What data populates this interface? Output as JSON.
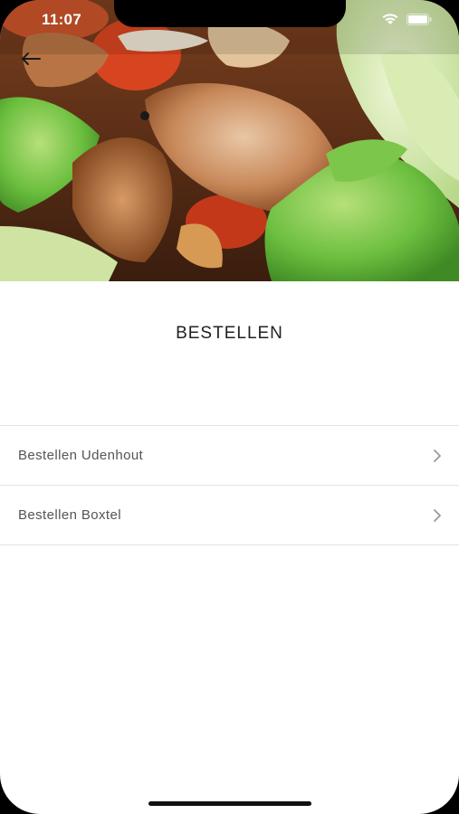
{
  "status_bar": {
    "time": "11:07",
    "icons": [
      "wifi-icon",
      "battery-icon"
    ]
  },
  "header": {
    "back_icon": "arrow-left-icon",
    "image": "food-photo"
  },
  "page": {
    "title": "BESTELLEN"
  },
  "list": {
    "items": [
      {
        "label": "Bestellen Udenhout",
        "icon": "chevron-right-icon"
      },
      {
        "label": "Bestellen Boxtel",
        "icon": "chevron-right-icon"
      }
    ]
  },
  "colors": {
    "background": "#ffffff",
    "title_text": "#222222",
    "item_text": "#555555",
    "divider": "#e2e2e2",
    "lettuce": "#5fae3a",
    "meat": "#b9784a"
  }
}
